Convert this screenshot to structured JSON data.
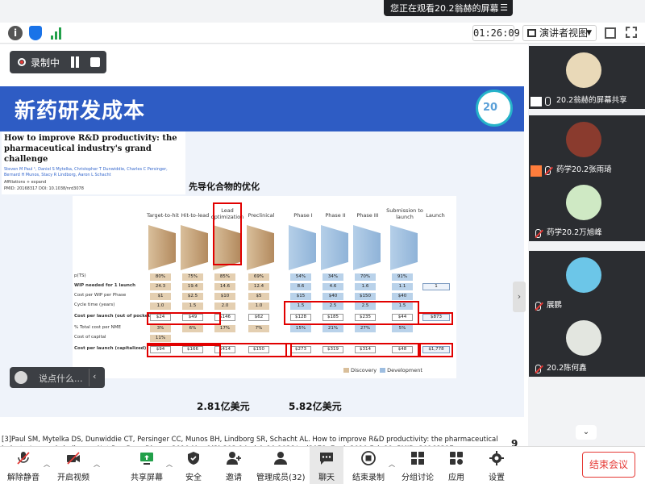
{
  "banner": {
    "text": "您正在观看20.2翁赫的屏幕",
    "menu_icon": "menu-icon"
  },
  "toolbar": {
    "timer": "01:26:09",
    "presenter_view": "演讲者视图"
  },
  "recording": {
    "label": "录制中"
  },
  "slide": {
    "title": "新药研发成本",
    "logo_text": "20",
    "paper": {
      "title": "How to improve R&D productivity: the pharmaceutical industry's grand challenge",
      "authors": "Steven M Paul ¹, Daniel S Mytelka, Christopher T Dunwiddie, Charles C Persinger, Bernard H Munos, Stacy R Lindborg, Aaron L Schacht",
      "affiliations": "Affiliations + expand",
      "pmid": "PMID: 20168317  DOI: 10.1038/nrd3078"
    },
    "heading": "先导化合物的优化",
    "cost1": "2.81亿美元",
    "cost2": "5.82亿美元",
    "reference": "[3]Paul SM, Mytelka DS, Dunwiddie CT, Persinger CC, Munos BH, Lindborg SR, Schacht AL. How to improve R&D productivity: the pharmaceutical industry's grand challenge. Nat Rev Drug Discov. 2010 Mar;9(3):203-14. doi: 10.1038/nrd3078. Epub 2010 Feb 19. PMID: 20168317.",
    "page": "9"
  },
  "figure": {
    "stages": [
      "Target-to-hit",
      "Hit-to-lead",
      "Lead optimization",
      "Preclinical",
      "Phase I",
      "Phase II",
      "Phase III",
      "Submission to launch",
      "Launch"
    ],
    "rows": [
      {
        "label": "p(TS)",
        "bold": false,
        "values": [
          "80%",
          "75%",
          "85%",
          "69%",
          "54%",
          "34%",
          "70%",
          "91%",
          ""
        ]
      },
      {
        "label": "WIP needed for 1 launch",
        "bold": true,
        "values": [
          "24.3",
          "19.4",
          "14.6",
          "12.4",
          "8.6",
          "4.6",
          "1.6",
          "1.1",
          "1"
        ]
      },
      {
        "label": "Cost per WIP per Phase",
        "bold": false,
        "values": [
          "$1",
          "$2.5",
          "$10",
          "$5",
          "$15",
          "$40",
          "$150",
          "$40",
          ""
        ]
      },
      {
        "label": "Cycle time (years)",
        "bold": false,
        "values": [
          "1.0",
          "1.5",
          "2.0",
          "1.0",
          "1.5",
          "2.5",
          "2.5",
          "1.5",
          ""
        ]
      },
      {
        "label": "Cost per launch (out of pocket)",
        "bold": true,
        "values": [
          "$24",
          "$49",
          "$146",
          "$62",
          "$128",
          "$185",
          "$235",
          "$44",
          "$873"
        ]
      },
      {
        "label": "% Total cost per NME",
        "bold": false,
        "values": [
          "3%",
          "6%",
          "17%",
          "7%",
          "15%",
          "21%",
          "27%",
          "5%",
          ""
        ]
      },
      {
        "label": "Cost of capital",
        "bold": false,
        "values": [
          "",
          "",
          "",
          "",
          "",
          "",
          "",
          "",
          ""
        ]
      },
      {
        "label": "Cost per launch (capitalized)",
        "bold": true,
        "values": [
          "$94",
          "$166",
          "$414",
          "$150",
          "$273",
          "$319",
          "$314",
          "$48",
          "$1,778"
        ]
      }
    ],
    "cost_of_capital": "11%",
    "legend": {
      "discovery": "Discovery",
      "development": "Development"
    }
  },
  "chat": {
    "placeholder": "说点什么..."
  },
  "participants": [
    {
      "name": "20.2翁赫的屏幕共享",
      "muted": false,
      "badge": "share"
    },
    {
      "name": "药学20.2张雨琦",
      "muted": true,
      "badge": "orange"
    },
    {
      "name": "药学20.2万旭峰",
      "muted": true,
      "badge": ""
    },
    {
      "name": "展鹏",
      "muted": true,
      "badge": ""
    },
    {
      "name": "20.2陈何鑫",
      "muted": true,
      "badge": ""
    }
  ],
  "bottom": {
    "unmute": "解除静音",
    "video": "开启视频",
    "share": "共享屏幕",
    "security": "安全",
    "invite": "邀请",
    "members": "管理成员(32)",
    "chat": "聊天",
    "end_record": "结束录制",
    "breakout": "分组讨论",
    "apps": "应用",
    "settings": "设置",
    "end_meeting": "结束会议"
  }
}
